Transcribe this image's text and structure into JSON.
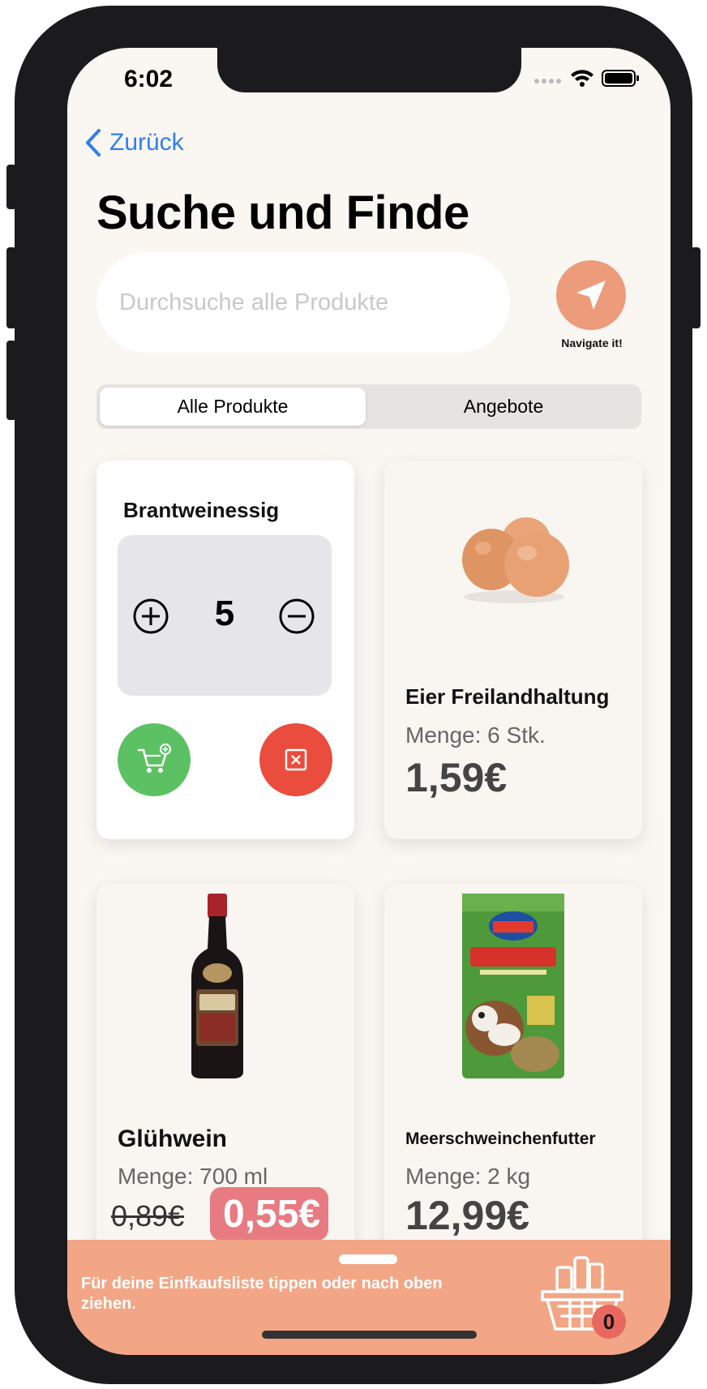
{
  "status_bar": {
    "time": "6:02"
  },
  "nav": {
    "back_label": "Zurück"
  },
  "page": {
    "title": "Suche und Finde"
  },
  "search": {
    "placeholder": "Durchsuche alle Produkte"
  },
  "navigate": {
    "label": "Navigate it!",
    "icon": "location-arrow-icon"
  },
  "segments": {
    "all": "Alle Produkte",
    "offers": "Angebote",
    "selected": "Alle Produkte"
  },
  "products": [
    {
      "name": "Brantweinessig",
      "quantity": "5",
      "add_icon": "cart-add-icon",
      "remove_icon": "close-square-icon"
    },
    {
      "name": "Eier Freilandhaltung",
      "amount": "Menge: 6 Stk.",
      "price": "1,59€",
      "image": "eggs"
    },
    {
      "name": "Glühwein",
      "amount": "Menge: 700 ml",
      "old_price": "0,89€",
      "price": "0,55€",
      "image": "mulled-wine-bottle"
    },
    {
      "name": "Meerschweinchenfutter",
      "amount": "Menge: 2 kg",
      "price": "12,99€",
      "image": "guinea-pig-food-bag"
    }
  ],
  "shopping_sheet": {
    "hint": "Für deine Einfkaufsliste tippen oder nach oben ziehen.",
    "count": "0",
    "icon": "shopping-basket-icon"
  },
  "colors": {
    "accent": "#2f80ed",
    "navigate": "#ec9b7b",
    "sheet": "#f2a686",
    "add": "#5cc162",
    "remove": "#ea4d3d",
    "sale": "#e87b82"
  }
}
